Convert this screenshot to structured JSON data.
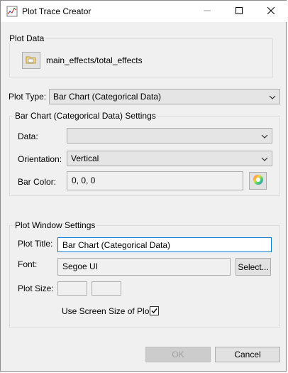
{
  "window": {
    "title": "Plot Trace Creator",
    "icon": "chart-icon"
  },
  "plot_data": {
    "group_title": "Plot Data",
    "path": "main_effects/total_effects",
    "button_icon": "folder-icon"
  },
  "plot_type": {
    "label": "Plot Type:",
    "value": "Bar Chart (Categorical Data)"
  },
  "bar_settings": {
    "group_title": "Bar Chart (Categorical Data) Settings",
    "data_label": "Data:",
    "data_value": "",
    "orientation_label": "Orientation:",
    "orientation_value": "Vertical",
    "bar_color_label": "Bar Color:",
    "bar_color_value": "0, 0, 0",
    "color_picker_icon": "color-wheel-icon"
  },
  "window_settings": {
    "group_title": "Plot Window Settings",
    "plot_title_label": "Plot Title:",
    "plot_title_value": "Bar Chart (Categorical Data)",
    "font_label": "Font:",
    "font_value": "Segoe UI",
    "select_button": "Select...",
    "plot_size_label": "Plot Size:",
    "plot_size_width": "",
    "plot_size_height": "",
    "screen_size_label": "Use Screen Size of Plot:",
    "screen_size_checked": true
  },
  "footer": {
    "ok_label": "OK",
    "cancel_label": "Cancel"
  }
}
